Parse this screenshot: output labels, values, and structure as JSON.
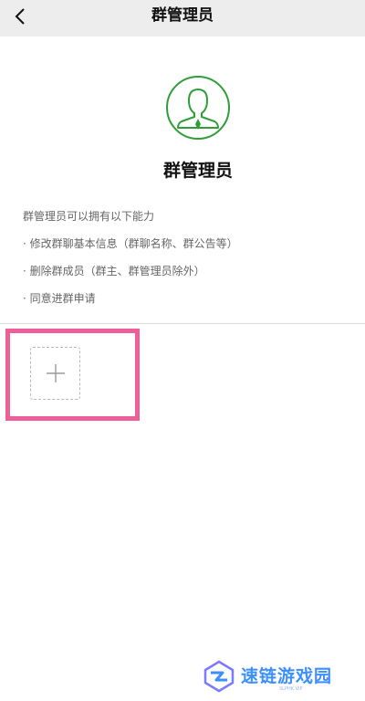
{
  "header": {
    "title": "群管理员"
  },
  "role": {
    "icon": "admin-avatar-icon",
    "title": "群管理员",
    "accent_color": "#2e9e3a"
  },
  "description": {
    "intro": "群管理员可以拥有以下能力",
    "items": [
      "· 修改群聊基本信息（群聊名称、群公告等）",
      "· 删除群成员（群主、群管理员除外）",
      "· 同意进群申请"
    ]
  },
  "add_member": {
    "icon": "plus-icon",
    "highlight_color": "#ee5e98"
  },
  "watermark": {
    "text": "速链游戏园",
    "sub": "SLPHK.VIP",
    "color": "#3c8fff"
  }
}
